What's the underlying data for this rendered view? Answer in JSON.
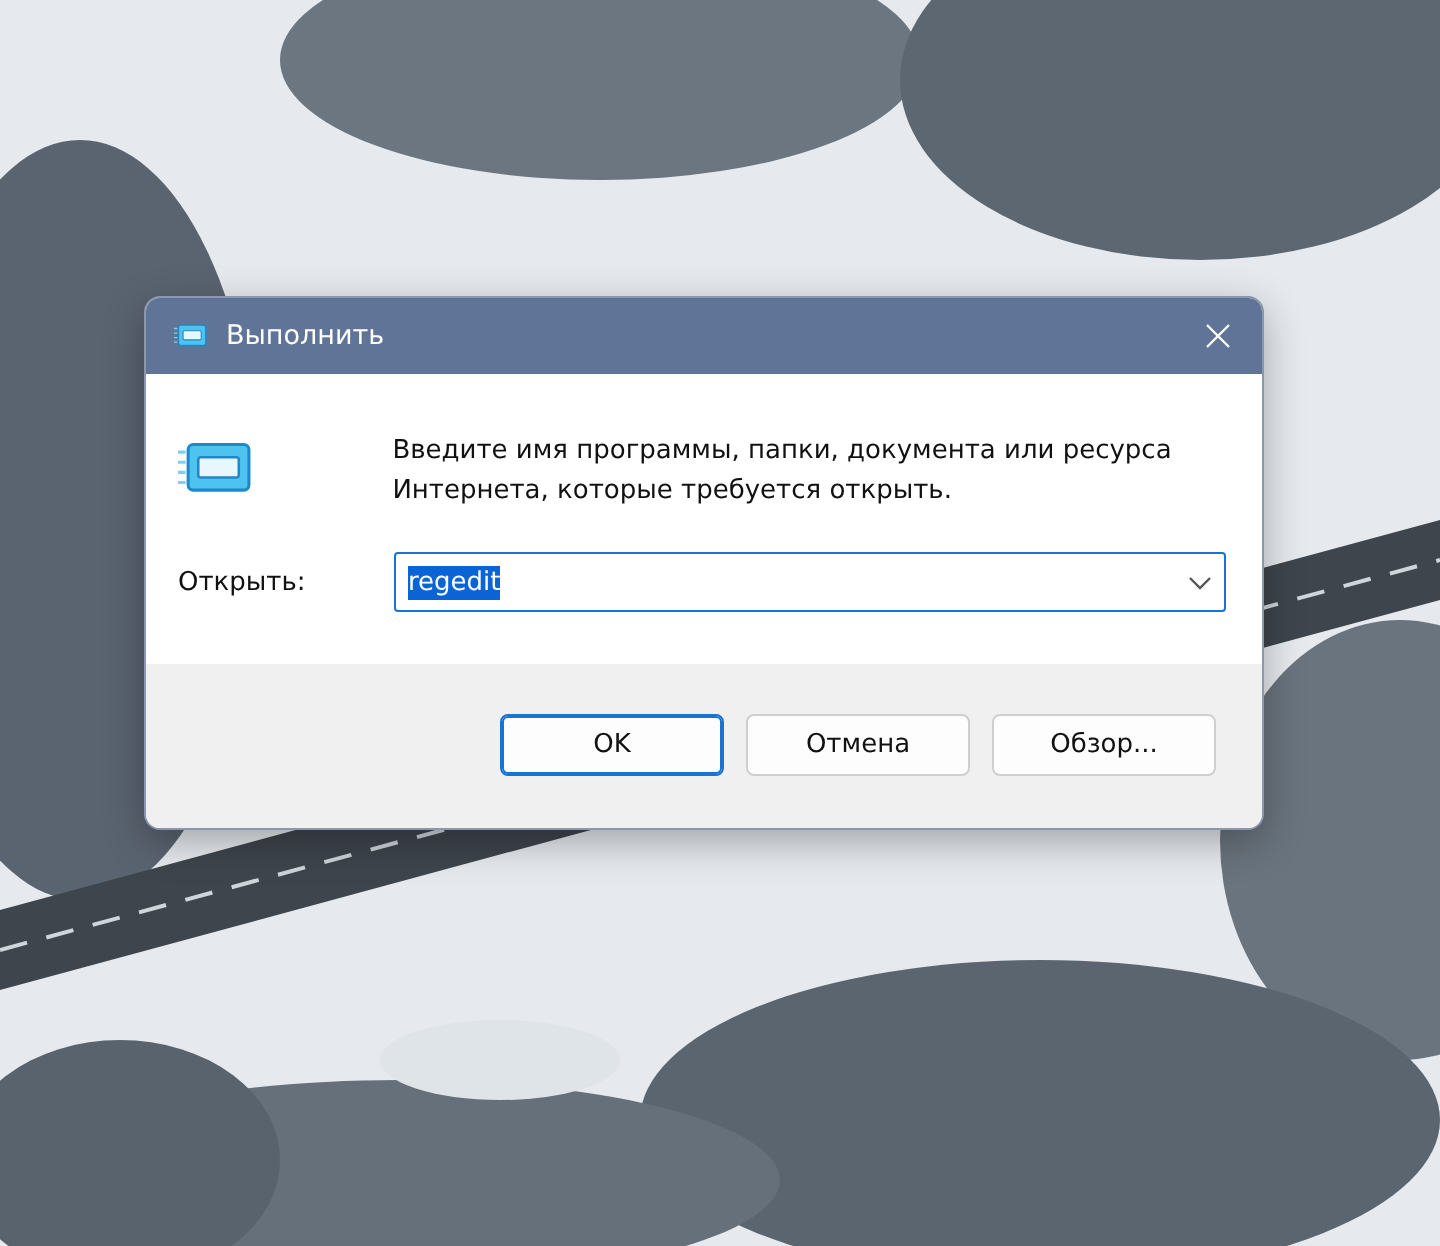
{
  "window": {
    "title": "Выполнить"
  },
  "message": "Введите имя программы, папки, документа или ресурса Интернета, которые требуется открыть.",
  "open_field": {
    "label": "Открыть:",
    "value": "regedit",
    "value_selected": true
  },
  "buttons": [
    {
      "label": "OK",
      "default": true
    },
    {
      "label": "Отмена",
      "default": false
    },
    {
      "label": "Обзор...",
      "default": false
    }
  ]
}
